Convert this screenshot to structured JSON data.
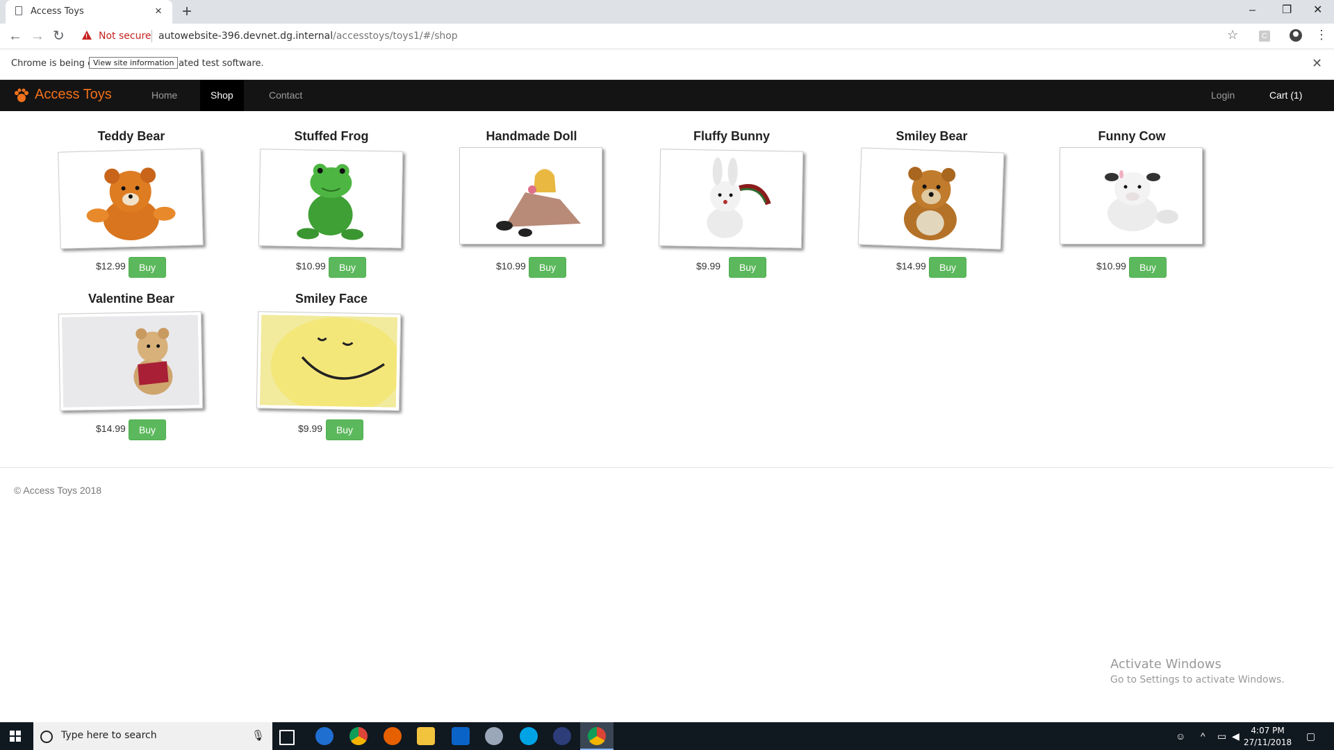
{
  "browser": {
    "tab_title": "Access Toys",
    "new_tab": "+",
    "tab_close": "×",
    "security_label": "Not secure",
    "url_host": "autowebsite-396.devnet.dg.internal",
    "url_path": "/accesstoys/toys1/#/shop",
    "infobar_text": "Chrome is being controlled by automated test software.",
    "tooltip": "View site information",
    "ext_letter": "C"
  },
  "site": {
    "brand": "Access Toys",
    "nav": [
      {
        "label": "Home"
      },
      {
        "label": "Shop"
      },
      {
        "label": "Contact"
      }
    ],
    "login": "Login",
    "cart": "Cart (1)"
  },
  "products": [
    {
      "name": "Teddy Bear",
      "price": "$12.99",
      "buy": "Buy"
    },
    {
      "name": "Stuffed Frog",
      "price": "$10.99",
      "buy": "Buy"
    },
    {
      "name": "Handmade Doll",
      "price": "$10.99",
      "buy": "Buy"
    },
    {
      "name": "Fluffy Bunny",
      "price": "$9.99",
      "buy": "Buy"
    },
    {
      "name": "Smiley Bear",
      "price": "$14.99",
      "buy": "Buy"
    },
    {
      "name": "Funny Cow",
      "price": "$10.99",
      "buy": "Buy"
    },
    {
      "name": "Valentine Bear",
      "price": "$14.99",
      "buy": "Buy"
    },
    {
      "name": "Smiley Face",
      "price": "$9.99",
      "buy": "Buy"
    }
  ],
  "footer": "© Access Toys 2018",
  "watermark": {
    "line1": "Activate Windows",
    "line2": "Go to Settings to activate Windows."
  },
  "taskbar": {
    "search_placeholder": "Type here to search",
    "time": "4:07 PM",
    "date": "27/11/2018"
  },
  "colors": {
    "brand": "#f2711c",
    "navbar": "#141414",
    "buy_button": "#5cb85c"
  }
}
